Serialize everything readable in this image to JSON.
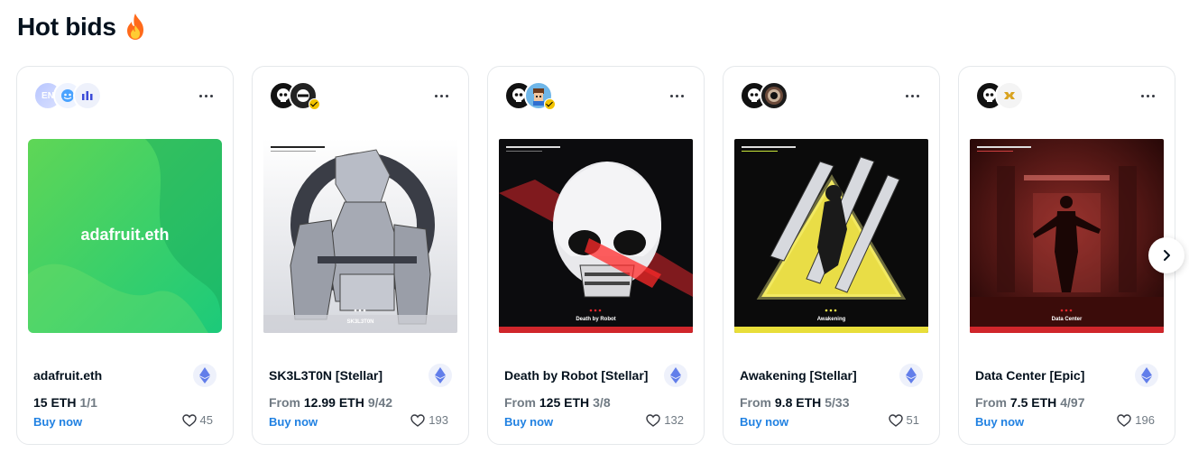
{
  "section": {
    "title": "Hot bids",
    "title_icon": "fire-icon"
  },
  "cards": [
    {
      "name": "adafruit.eth",
      "from": "",
      "price": "15 ETH",
      "editions": "1/1",
      "buy": "Buy now",
      "likes": "45",
      "art_text": "adafruit.eth",
      "avatar_text": "EN",
      "art_caption": ""
    },
    {
      "name": "SK3L3T0N [Stellar]",
      "from": "From",
      "price": "12.99 ETH",
      "editions": "9/42",
      "buy": "Buy now",
      "likes": "193",
      "art_text": "",
      "avatar_text": "",
      "art_caption": "SK3L3T0N"
    },
    {
      "name": "Death by Robot [Stellar]",
      "from": "From",
      "price": "125 ETH",
      "editions": "3/8",
      "buy": "Buy now",
      "likes": "132",
      "art_text": "",
      "avatar_text": "",
      "art_caption": "Death by Robot"
    },
    {
      "name": "Awakening [Stellar]",
      "from": "From",
      "price": "9.8 ETH",
      "editions": "5/33",
      "buy": "Buy now",
      "likes": "51",
      "art_text": "",
      "avatar_text": "",
      "art_caption": "Awakening"
    },
    {
      "name": "Data Center [Epic]",
      "from": "From",
      "price": "7.5 ETH",
      "editions": "4/97",
      "buy": "Buy now",
      "likes": "196",
      "art_text": "",
      "avatar_text": "",
      "art_caption": "Data Center"
    }
  ],
  "colors": {
    "link": "#2081e2",
    "muted": "#707a83",
    "text": "#04111d",
    "border": "#e5e8eb",
    "rarity_red": "#e5484d"
  },
  "icons": {
    "more": "more-horizontal-icon",
    "chain": "ethereum-icon",
    "like": "heart-icon",
    "next": "chevron-right-icon"
  }
}
